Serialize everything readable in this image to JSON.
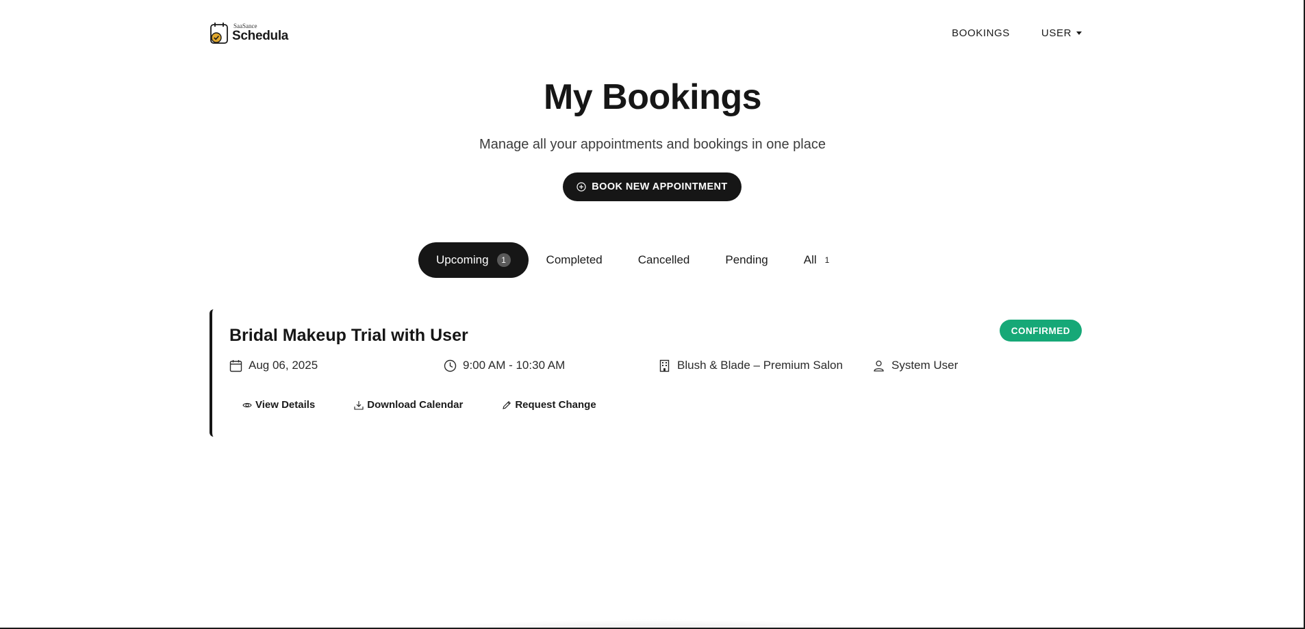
{
  "header": {
    "logo_small": "SaaSance",
    "logo_big": "Schedula",
    "nav_bookings": "BOOKINGS",
    "nav_user": "USER"
  },
  "hero": {
    "title": "My Bookings",
    "subtitle": "Manage all your appointments and bookings in one place",
    "book_button": "BOOK NEW APPOINTMENT"
  },
  "tabs": [
    {
      "label": "Upcoming",
      "count": "1",
      "active": true
    },
    {
      "label": "Completed"
    },
    {
      "label": "Cancelled"
    },
    {
      "label": "Pending"
    },
    {
      "label": "All",
      "count": "1"
    }
  ],
  "booking": {
    "title": "Bridal Makeup Trial with User",
    "status": "CONFIRMED",
    "date": "Aug 06, 2025",
    "time": "9:00 AM - 10:30 AM",
    "location": "Blush & Blade – Premium Salon",
    "staff": "System User",
    "actions": {
      "view": "View Details",
      "download": "Download Calendar",
      "request": "Request Change"
    }
  },
  "colors": {
    "primary": "#161616",
    "confirmed": "#16a877",
    "logo_accent": "#e0a82e"
  },
  "icons": [
    "calendar-icon",
    "clock-icon",
    "building-icon",
    "person-icon",
    "eye-icon",
    "download-icon",
    "pencil-icon",
    "plus-circle-icon",
    "caret-down-icon"
  ]
}
